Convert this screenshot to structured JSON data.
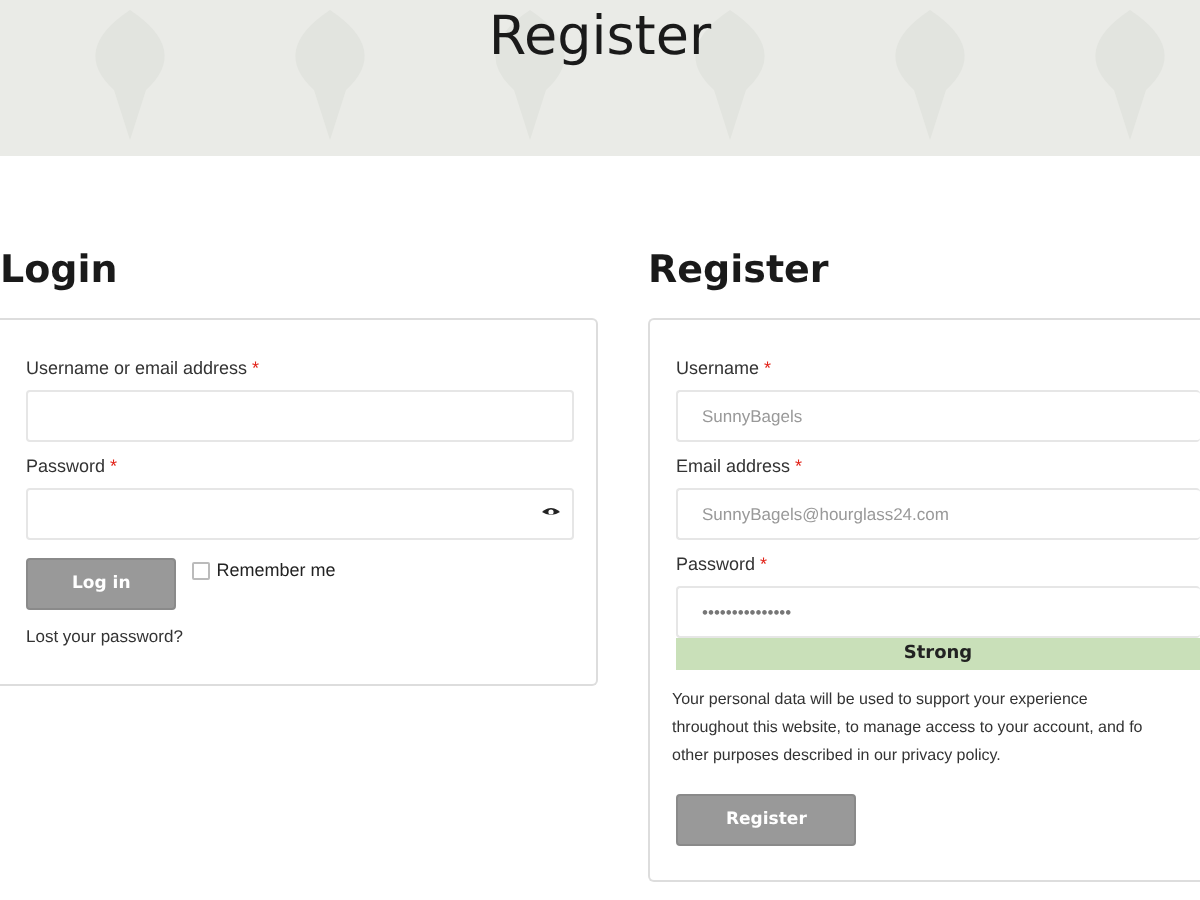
{
  "header": {
    "title": "Register"
  },
  "login": {
    "heading": "Login",
    "fields": [
      {
        "label": "Username or email address",
        "required_mark": "*",
        "kind": "text"
      },
      {
        "label": "Password",
        "required_mark": "*",
        "kind": "password"
      }
    ],
    "button": "Log in",
    "remember": {
      "label": "Remember me",
      "checked": false
    },
    "lost_password": "Lost your password?"
  },
  "register": {
    "heading": "Register",
    "fields": [
      {
        "label": "Username",
        "required_mark": "*",
        "kind": "text",
        "value": "SunnyBagels"
      },
      {
        "label": "Email address",
        "required_mark": "*",
        "kind": "text",
        "value": "SunnyBagels@hourglass24.com"
      },
      {
        "label": "Password",
        "required_mark": "*",
        "kind": "password-strength",
        "value": "•••••••••••••••",
        "strength": "Strong"
      }
    ],
    "privacy_note": "Your personal data will be used to support your experience\nthroughout this website, to manage access to your account, and fo\nother purposes described in our privacy policy.",
    "button": "Register"
  }
}
